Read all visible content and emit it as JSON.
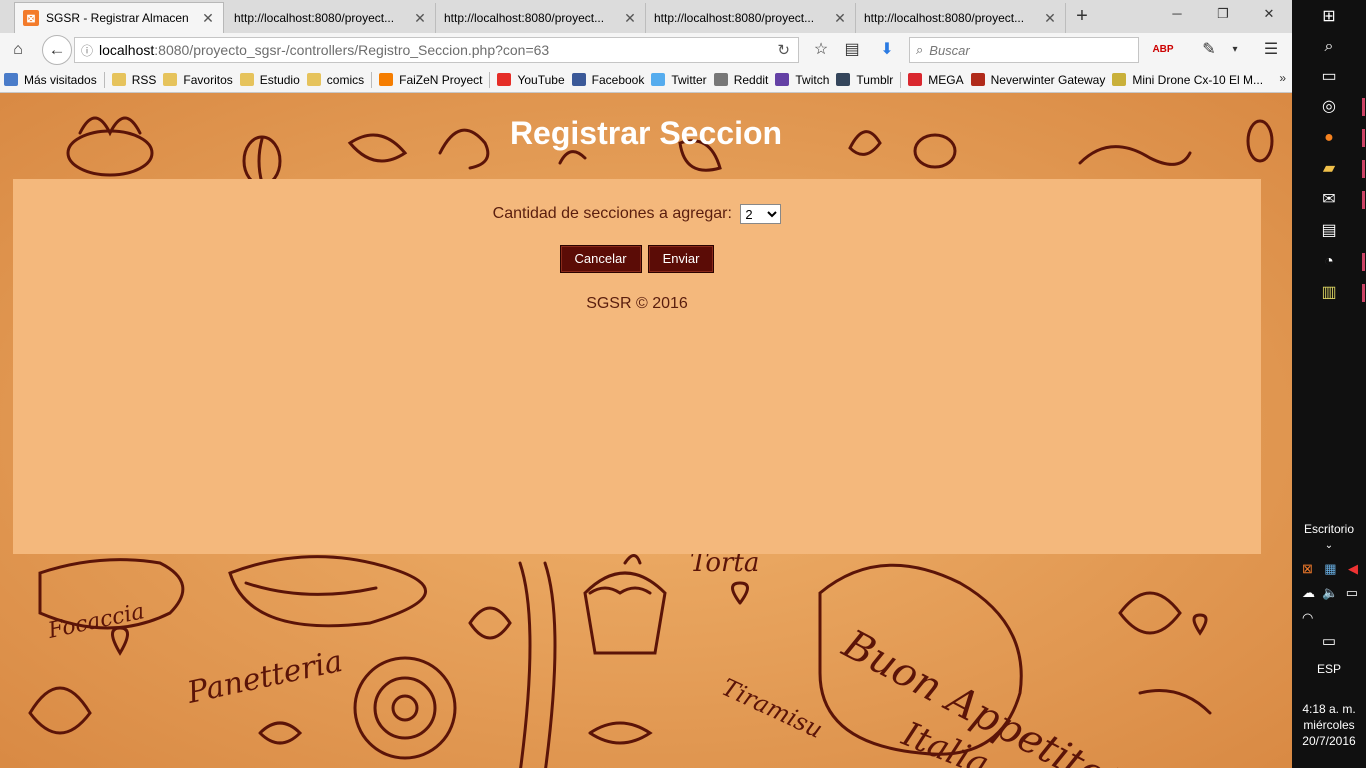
{
  "browser": {
    "tabs": [
      {
        "label": "SGSR - Registrar Almacen",
        "active": true
      },
      {
        "label": "http://localhost:8080/proyect...",
        "active": false
      },
      {
        "label": "http://localhost:8080/proyect...",
        "active": false
      },
      {
        "label": "http://localhost:8080/proyect...",
        "active": false
      },
      {
        "label": "http://localhost:8080/proyect...",
        "active": false
      }
    ],
    "url_host": "localhost",
    "url_path": ":8080/proyecto_sgsr-/controllers/Registro_Seccion.php?con=63",
    "search_placeholder": "Buscar",
    "bookmarks": [
      {
        "label": "Más visitados",
        "icon": "globe-icon",
        "color": "#4a7cc9"
      },
      {
        "label": "RSS",
        "icon": "folder-icon",
        "color": "#e6c35c"
      },
      {
        "label": "Favoritos",
        "icon": "folder-icon",
        "color": "#e6c35c"
      },
      {
        "label": "Estudio",
        "icon": "folder-icon",
        "color": "#e6c35c"
      },
      {
        "label": "comics",
        "icon": "folder-icon",
        "color": "#e6c35c"
      },
      {
        "label": "FaiZeN Proyect",
        "icon": "blogger-icon",
        "color": "#f57d00"
      },
      {
        "label": "YouTube",
        "icon": "youtube-icon",
        "color": "#e52d27"
      },
      {
        "label": "Facebook",
        "icon": "facebook-icon",
        "color": "#3b5998"
      },
      {
        "label": "Twitter",
        "icon": "twitter-icon",
        "color": "#55acee"
      },
      {
        "label": "Reddit",
        "icon": "reddit-icon",
        "color": "#777777"
      },
      {
        "label": "Twitch",
        "icon": "twitch-icon",
        "color": "#6441a5"
      },
      {
        "label": "Tumblr",
        "icon": "tumblr-icon",
        "color": "#35465c"
      },
      {
        "label": "MEGA",
        "icon": "mega-icon",
        "color": "#d9272e"
      },
      {
        "label": "Neverwinter Gateway",
        "icon": "neverwinter-icon",
        "color": "#b02a1a"
      },
      {
        "label": "Mini Drone Cx-10 El M...",
        "icon": "drone-icon",
        "color": "#c9b03a"
      }
    ]
  },
  "page": {
    "title": "Registrar Seccion",
    "quantity_label": "Cantidad de secciones a agregar:",
    "quantity_value": "2",
    "cancel_label": "Cancelar",
    "submit_label": "Enviar",
    "footer": "SGSR © 2016"
  },
  "taskbar": {
    "desktop_label": "Escritorio",
    "language": "ESP",
    "time": "4:18 a. m.",
    "day": "miércoles",
    "date": "20/7/2016"
  },
  "colors": {
    "page_background": "#e39a55",
    "panel_background": "#f4b87c",
    "button_background": "#5b0c06",
    "text_brown": "#5a1e0e"
  }
}
